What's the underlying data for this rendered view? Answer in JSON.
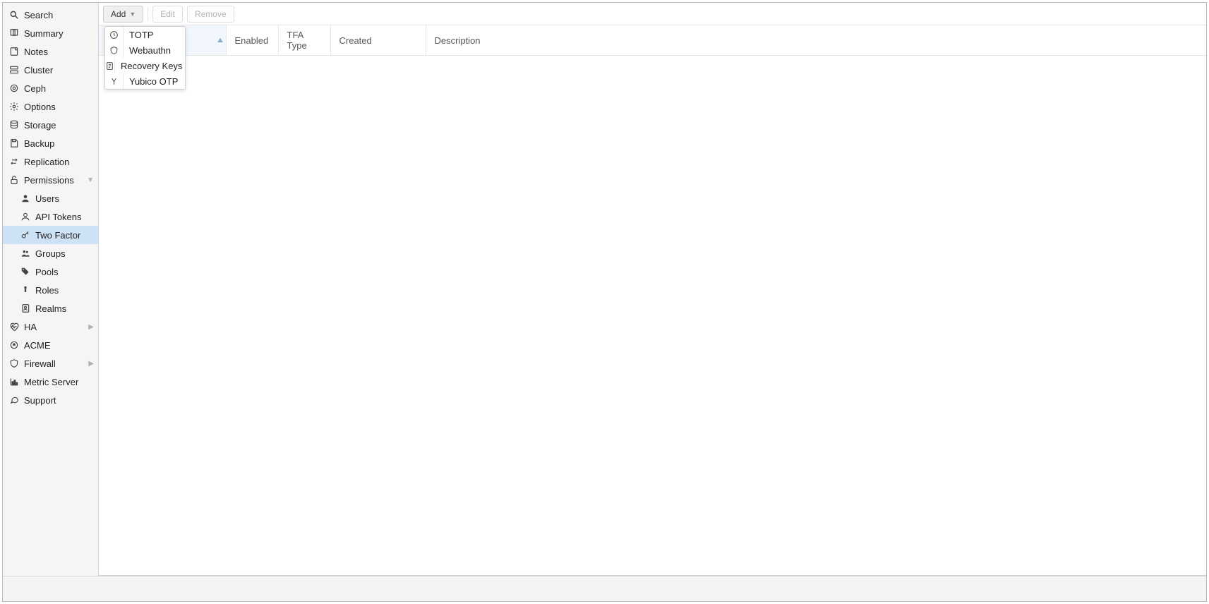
{
  "sidebar": {
    "items": [
      {
        "label": "Search"
      },
      {
        "label": "Summary"
      },
      {
        "label": "Notes"
      },
      {
        "label": "Cluster"
      },
      {
        "label": "Ceph"
      },
      {
        "label": "Options"
      },
      {
        "label": "Storage"
      },
      {
        "label": "Backup"
      },
      {
        "label": "Replication"
      },
      {
        "label": "Permissions"
      }
    ],
    "perm_children": [
      {
        "label": "Users"
      },
      {
        "label": "API Tokens"
      },
      {
        "label": "Two Factor"
      },
      {
        "label": "Groups"
      },
      {
        "label": "Pools"
      },
      {
        "label": "Roles"
      },
      {
        "label": "Realms"
      }
    ],
    "tail": [
      {
        "label": "HA"
      },
      {
        "label": "ACME"
      },
      {
        "label": "Firewall"
      },
      {
        "label": "Metric Server"
      },
      {
        "label": "Support"
      }
    ]
  },
  "toolbar": {
    "add": "Add",
    "edit": "Edit",
    "remove": "Remove"
  },
  "add_menu": [
    {
      "label": "TOTP"
    },
    {
      "label": "Webauthn"
    },
    {
      "label": "Recovery Keys"
    },
    {
      "label": "Yubico OTP"
    }
  ],
  "columns": {
    "user": "",
    "enabled": "Enabled",
    "tfa_type": "TFA Type",
    "created": "Created",
    "description": "Description"
  }
}
